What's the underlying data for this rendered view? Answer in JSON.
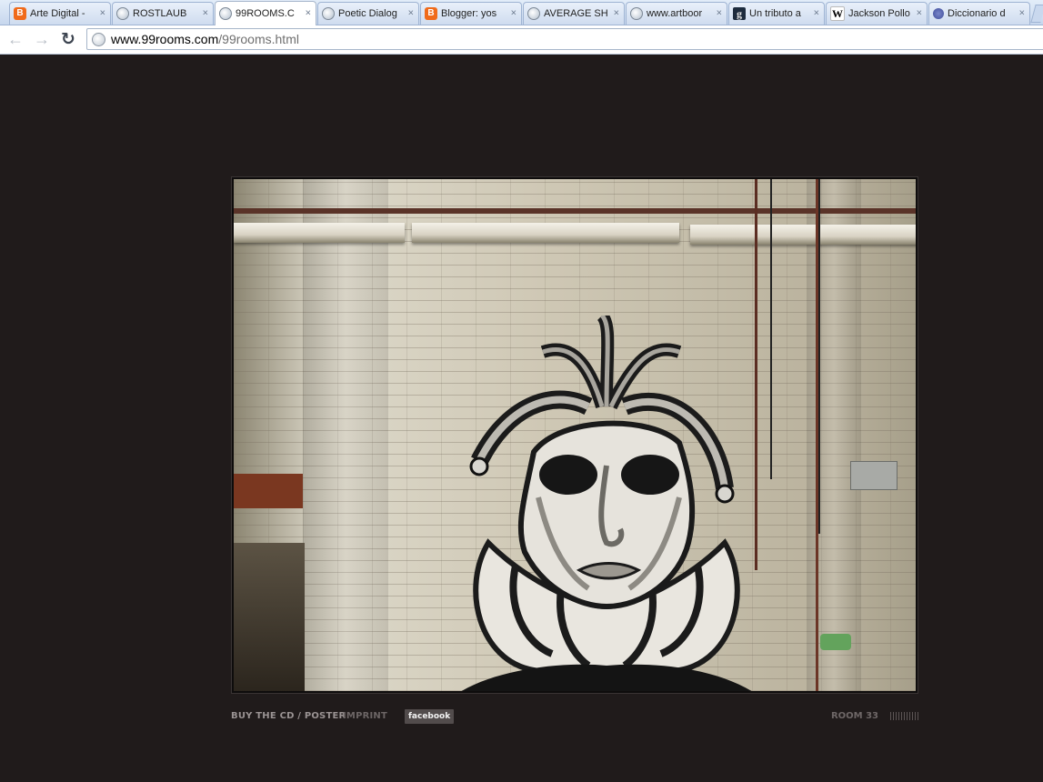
{
  "browser": {
    "tabs": [
      {
        "label": "Arte Digital -",
        "icon": "blogger-icon",
        "active": false
      },
      {
        "label": "ROSTLAUB",
        "icon": "globe-icon",
        "active": false
      },
      {
        "label": "99ROOMS.C",
        "icon": "globe-icon",
        "active": true
      },
      {
        "label": "Poetic Dialog",
        "icon": "globe-icon",
        "active": false
      },
      {
        "label": "Blogger: yos",
        "icon": "blogger-icon",
        "active": false
      },
      {
        "label": "AVERAGE SH",
        "icon": "globe-icon",
        "active": false
      },
      {
        "label": "www.artboor",
        "icon": "globe-icon",
        "active": false
      },
      {
        "label": "Un tributo a",
        "icon": "goodreads-icon",
        "active": false
      },
      {
        "label": "Jackson Pollo",
        "icon": "wikipedia-icon",
        "active": false
      },
      {
        "label": "Diccionario d",
        "icon": "seal-icon",
        "active": false
      }
    ],
    "tab_close_glyph": "×",
    "nav": {
      "back_glyph": "←",
      "forward_glyph": "→",
      "reload_glyph": "↻"
    },
    "address": {
      "host": "www.99rooms.com",
      "path": "/99rooms.html"
    }
  },
  "page": {
    "footer": {
      "buy_label": "BUY THE CD / POSTER",
      "imprint_label": "IMPRINT",
      "facebook_label": "facebook",
      "room_label": "ROOM 33"
    },
    "photo_alt": "jester mural painted on brick wall"
  },
  "colors": {
    "page_background": "#201b1b",
    "tabstrip": "#c7d7ee",
    "blogger_orange": "#f06a1a"
  }
}
